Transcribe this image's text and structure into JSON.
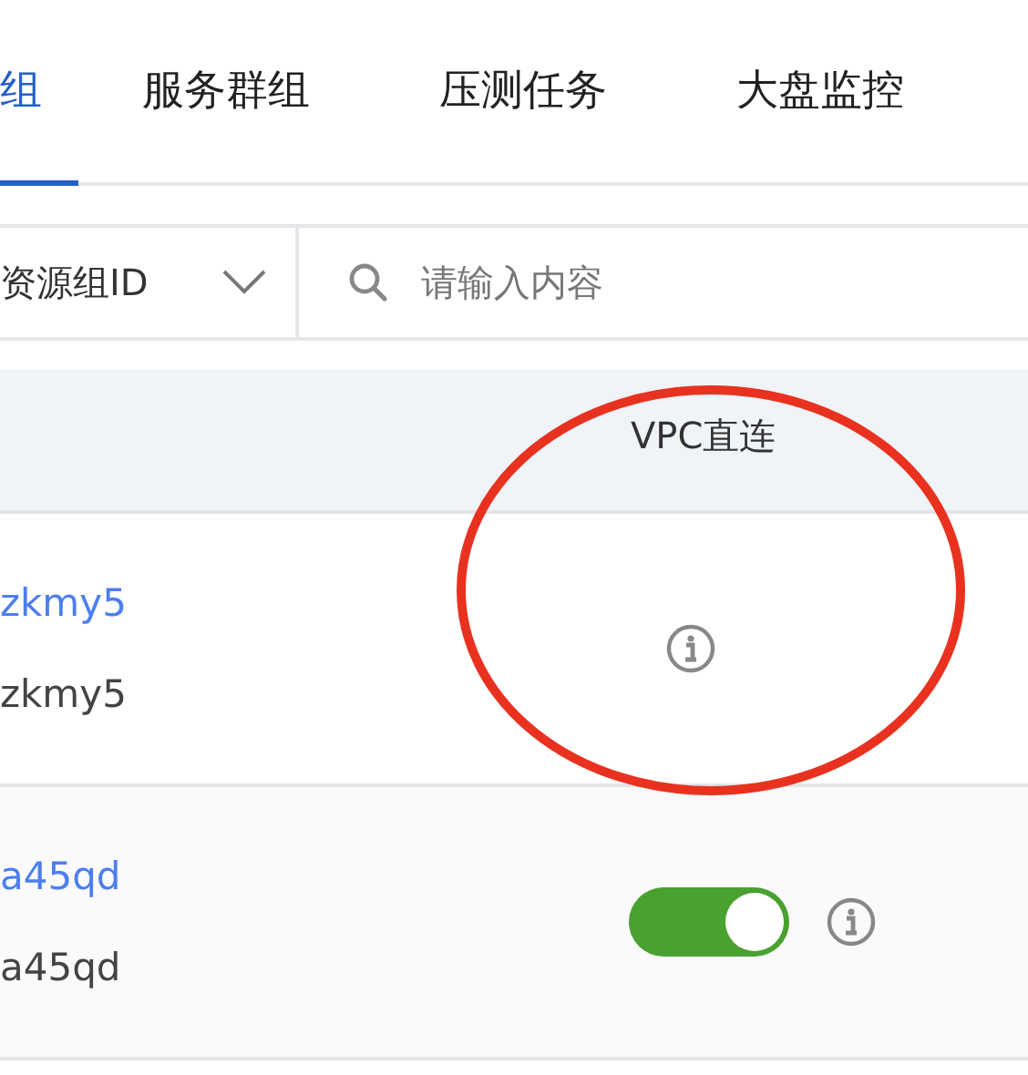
{
  "tabs": [
    {
      "label": "组",
      "selected": true
    },
    {
      "label": "服务群组",
      "selected": false
    },
    {
      "label": "压测任务",
      "selected": false
    },
    {
      "label": "大盘监控",
      "selected": false
    }
  ],
  "filter": {
    "select_value": "资源组ID",
    "search_placeholder": "请输入内容"
  },
  "table": {
    "columns": [
      "VPC直连"
    ],
    "rows": [
      {
        "link": "zkmy5",
        "text": "zkmy5"
      },
      {
        "link": "a45qd",
        "text": "a45qd",
        "vpc_on": true
      }
    ]
  }
}
